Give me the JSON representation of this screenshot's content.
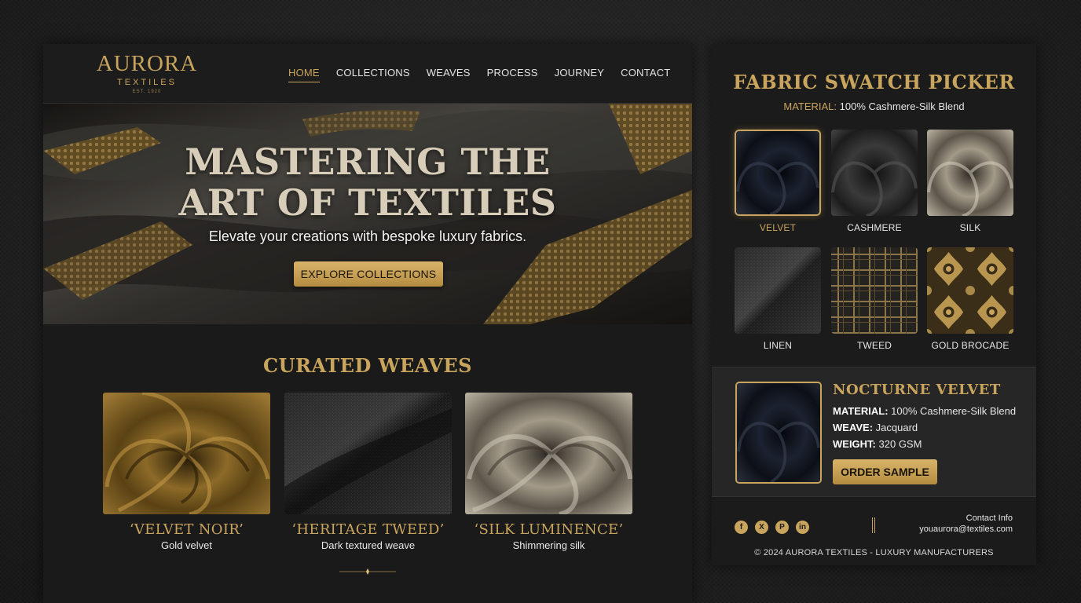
{
  "brand": {
    "name": "AURORA",
    "subtitle": "TEXTILES",
    "est": "EST. 1920"
  },
  "nav": {
    "items": [
      "HOME",
      "COLLECTIONS",
      "WEAVES",
      "PROCESS",
      "JOURNEY",
      "CONTACT"
    ],
    "active": "HOME"
  },
  "hero": {
    "title_line1": "MASTERING THE",
    "title_line2": "ART OF TEXTILES",
    "subtitle": "Elevate your creations with bespoke luxury fabrics.",
    "cta": "EXPLORE COLLECTIONS"
  },
  "curated": {
    "title": "CURATED WEAVES",
    "cards": [
      {
        "name": "‘VELVET NOIR’",
        "desc": "Gold velvet"
      },
      {
        "name": "‘HERITAGE TWEED’",
        "desc": "Dark textured weave"
      },
      {
        "name": "‘SILK LUMINENCE’",
        "desc": "Shimmering silk"
      }
    ]
  },
  "picker": {
    "title": "FABRIC SWATCH PICKER",
    "material_label": "MATERIAL:",
    "material_value": "100% Cashmere-Silk Blend",
    "swatches": [
      "VELVET",
      "CASHMERE",
      "SILK",
      "LINEN",
      "TWEED",
      "GOLD BROCADE"
    ],
    "selected": "VELVET"
  },
  "detail": {
    "title": "NOCTURNE VELVET",
    "material_label": "MATERIAL:",
    "material_value": "100% Cashmere-Silk Blend",
    "weave_label": "WEAVE:",
    "weave_value": "Jacquard",
    "weight_label": "WEIGHT:",
    "weight_value": "320 GSM",
    "cta": "ORDER SAMPLE"
  },
  "footer": {
    "social": [
      "facebook-icon",
      "x-icon",
      "pinterest-icon",
      "linkedin-icon"
    ],
    "contact_label": "Contact Info",
    "contact_email": "youaurora@textiles.com",
    "copyright": "© 2024 AURORA TEXTILES - LUXURY MANUFACTURERS"
  },
  "colors": {
    "gold": "#c9a45c",
    "panel": "#1a1a1a",
    "background": "#222222"
  }
}
